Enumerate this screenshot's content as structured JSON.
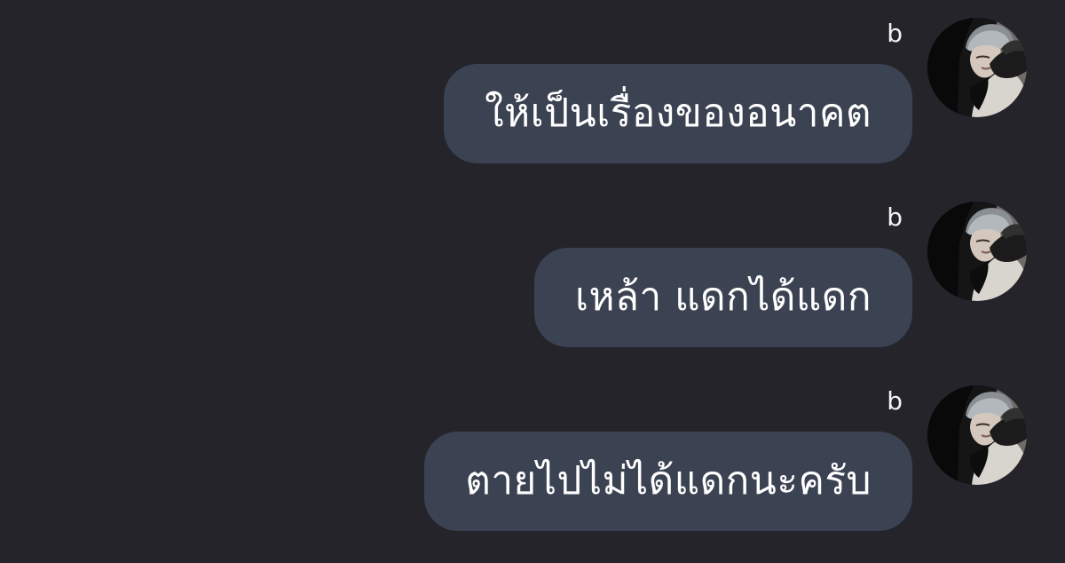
{
  "messages": [
    {
      "sender": "b",
      "text": "ให้เป็นเรื่องของอนาคต",
      "avatar_icon": "user-avatar"
    },
    {
      "sender": "b",
      "text": "เหล้า แดกได้แดก",
      "avatar_icon": "user-avatar"
    },
    {
      "sender": "b",
      "text": "ตายไปไม่ได้แดกนะครับ",
      "avatar_icon": "user-avatar"
    }
  ],
  "colors": {
    "background": "#24242a",
    "bubble": "#3b4252",
    "text": "#ffffff",
    "sender_text": "#f2f2f2"
  }
}
